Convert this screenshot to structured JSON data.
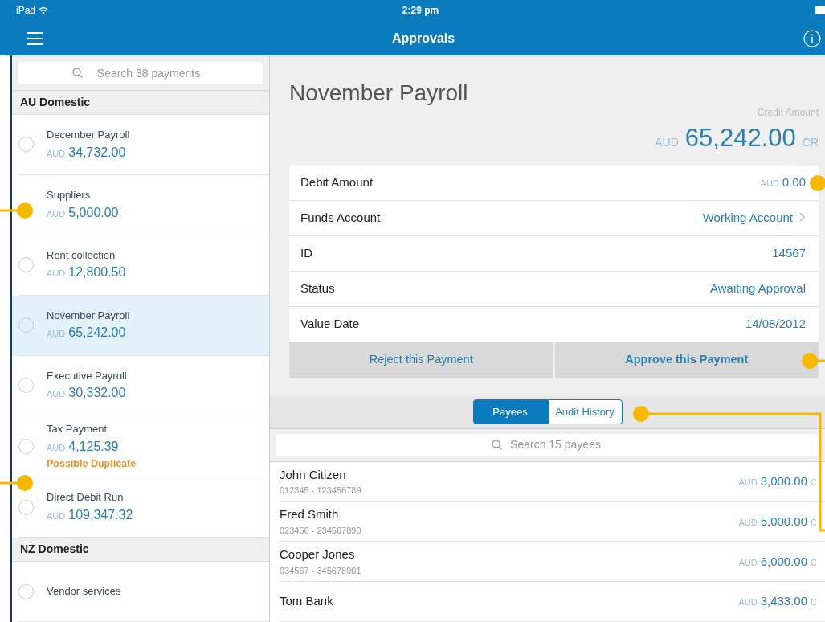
{
  "status_bar": {
    "carrier": "iPad",
    "time": "2:29 pm"
  },
  "nav_bar": {
    "title": "Approvals"
  },
  "payments": {
    "search_placeholder": "Search 38 payments",
    "groups": [
      {
        "title": "AU Domestic",
        "items": [
          {
            "name": "December Payroll",
            "currency": "AUD",
            "amount": "34,732.00",
            "checked": false,
            "selected": false
          },
          {
            "name": "Suppliers",
            "currency": "AUD",
            "amount": "5,000.00",
            "selected": false
          },
          {
            "name": "Rent collection",
            "currency": "AUD",
            "amount": "12,800.50",
            "checked": false,
            "selected": false
          },
          {
            "name": "November Payroll",
            "currency": "AUD",
            "amount": "65,242.00",
            "checked": false,
            "selected": true
          },
          {
            "name": "Executive Payroll",
            "currency": "AUD",
            "amount": "30,332.00",
            "checked": false,
            "selected": false
          },
          {
            "name": "Tax Payment",
            "currency": "AUD",
            "amount": "4,125.39",
            "warning": "Possible Duplicate",
            "checked": false,
            "selected": false
          },
          {
            "name": "Direct Debit Run",
            "currency": "AUD",
            "amount": "109,347.32",
            "checked": false,
            "selected": false
          }
        ]
      },
      {
        "title": "NZ Domestic",
        "items": [
          {
            "name": "Vendor services",
            "checked": false,
            "selected": false
          }
        ]
      }
    ]
  },
  "detail": {
    "title": "November Payroll",
    "credit_label": "Credit Amount",
    "credit_currency": "AUD",
    "credit_amount": "65,242.00",
    "credit_suffix": "CR",
    "fields": [
      {
        "kind": "amount",
        "label": "Debit Amount",
        "currency": "AUD",
        "value": "0.00"
      },
      {
        "kind": "link",
        "label": "Funds Account",
        "value": "Working Account"
      },
      {
        "kind": "text",
        "label": "ID",
        "value": "14567"
      },
      {
        "kind": "text",
        "label": "Status",
        "value": "Awaiting Approval"
      },
      {
        "kind": "text",
        "label": "Value Date",
        "value": "14/08/2012"
      }
    ],
    "actions": [
      {
        "label": "Reject this Payment",
        "emphasis": false
      },
      {
        "label": "Approve this Payment",
        "emphasis": true
      }
    ]
  },
  "segments": [
    {
      "label": "Payees",
      "selected": true
    },
    {
      "label": "Audit History",
      "selected": false
    }
  ],
  "payees": {
    "search_placeholder": "Search 15 payees",
    "rows": [
      {
        "name": "John Citizen",
        "account": "012345 - 123456789",
        "currency": "AUD",
        "amount": "3,000.00",
        "suffix": "C"
      },
      {
        "name": "Fred Smith",
        "account": "023456 - 234567890",
        "currency": "AUD",
        "amount": "5,000.00",
        "suffix": "C"
      },
      {
        "name": "Cooper Jones",
        "account": "034567 - 345678901",
        "currency": "AUD",
        "amount": "6,000.00",
        "suffix": "C"
      },
      {
        "name": "Tom Bank",
        "currency": "AUD",
        "amount": "3,433.00",
        "suffix": "C"
      }
    ]
  }
}
